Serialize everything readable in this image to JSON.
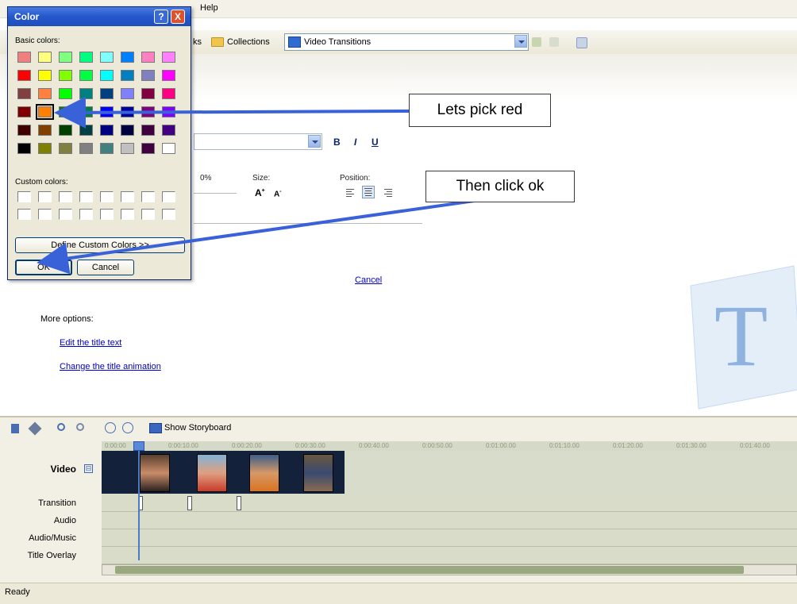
{
  "menu": {
    "help_label": "Help"
  },
  "toolbar": {
    "tasks_fragment": "ks",
    "collections_label": "Collections",
    "view_value": "Video Transitions"
  },
  "title_editor": {
    "bold": "B",
    "italic": "I",
    "underline": "U",
    "transparency_pct": "0%",
    "size_label": "Size:",
    "position_label": "Position:",
    "cancel_link": "Cancel",
    "more_options": "More options:",
    "edit_title_text": "Edit the title text",
    "change_title_animation": "Change the title animation"
  },
  "watermark": {
    "letter": "T"
  },
  "color_dialog": {
    "title": "Color",
    "help_btn": "?",
    "close_btn": "X",
    "basic_colors_label": "Basic colors:",
    "custom_colors_label": "Custom colors:",
    "define_custom": "Define Custom Colors >>",
    "ok": "OK",
    "cancel": "Cancel",
    "basic_colors": [
      [
        "#f08080",
        "#ffff80",
        "#80ff80",
        "#00ff80",
        "#80ffff",
        "#0080ff",
        "#ff80c0",
        "#ff80ff"
      ],
      [
        "#ff0000",
        "#ffff00",
        "#80ff00",
        "#00ff40",
        "#00ffff",
        "#0080c0",
        "#8080c0",
        "#ff00ff"
      ],
      [
        "#804040",
        "#ff8040",
        "#00ff00",
        "#008080",
        "#004080",
        "#8080ff",
        "#800040",
        "#ff0080"
      ],
      [
        "#800000",
        "#ff8000",
        "#008000",
        "#008040",
        "#0000ff",
        "#0000a0",
        "#800080",
        "#8000ff"
      ],
      [
        "#400000",
        "#804000",
        "#004000",
        "#004040",
        "#000080",
        "#000040",
        "#400040",
        "#400080"
      ],
      [
        "#000000",
        "#808000",
        "#808040",
        "#808080",
        "#408080",
        "#c0c0c0",
        "#400040",
        "#ffffff"
      ]
    ],
    "selected_swatch": "row 4, column 2"
  },
  "callouts": {
    "pick_red": "Lets pick red",
    "click_ok": "Then click ok"
  },
  "timeline": {
    "show_storyboard": "Show Storyboard",
    "tracks": {
      "video": "Video",
      "transition": "Transition",
      "audio": "Audio",
      "audio_music": "Audio/Music",
      "title_overlay": "Title Overlay"
    },
    "ruler_ticks": [
      "0:00:00",
      "0:00:10.00",
      "0:00:20.00",
      "0:00:30.00",
      "0:00:40.00",
      "0:00:50.00",
      "0:01:00.00",
      "0:01:10.00",
      "0:01:20.00",
      "0:01:30.00",
      "0:01:40.00"
    ]
  },
  "status": {
    "text": "Ready"
  },
  "colors": {
    "accent_arrow": "#3a62d8",
    "title_bar": "#2457cb"
  }
}
